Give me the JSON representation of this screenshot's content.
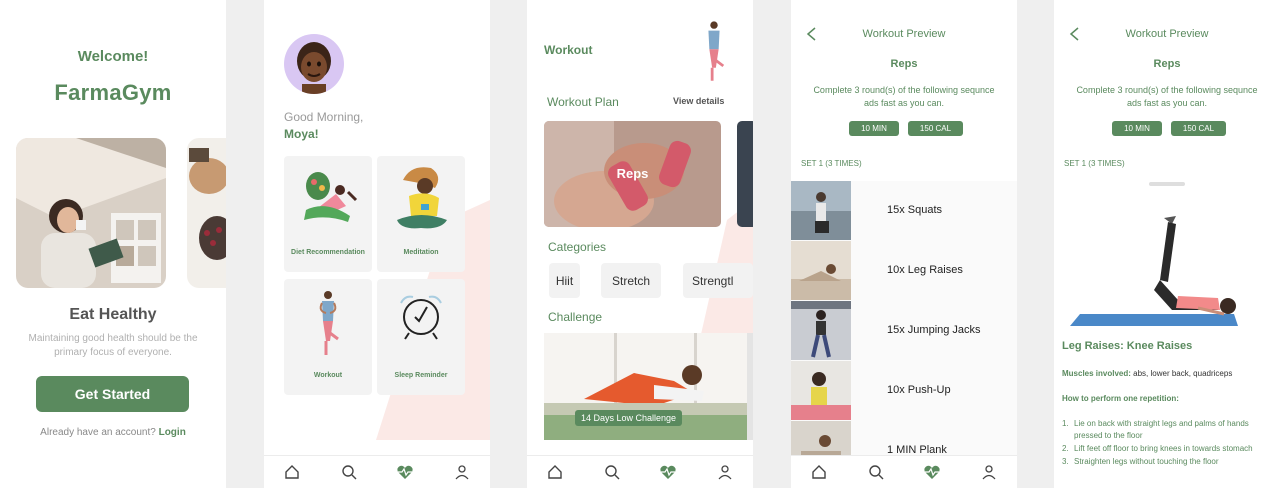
{
  "screen1": {
    "welcome": "Welcome!",
    "brand": "FarmaGym",
    "title": "Eat Healthy",
    "subtitle": "Maintaining good health should be the primary focus of everyone.",
    "cta": "Get Started",
    "account_prompt": "Already have an account?",
    "login": "Login"
  },
  "screen2": {
    "greeting": "Good Morning,",
    "name": "Moya!",
    "tiles": [
      {
        "label": "Diet Recommendation",
        "icon": "diet-illustration-icon"
      },
      {
        "label": "Meditation",
        "icon": "meditation-illustration-icon"
      },
      {
        "label": "Workout",
        "icon": "workout-illustration-icon"
      },
      {
        "label": "Sleep Reminder",
        "icon": "alarm-clock-icon"
      }
    ]
  },
  "screen3": {
    "title": "Workout",
    "plan_label": "Workout Plan",
    "view_details": "View details",
    "card_label": "Reps",
    "categories_label": "Categories",
    "categories": [
      "Hiit",
      "Stretch",
      "Strengtl"
    ],
    "challenge_label": "Challenge",
    "challenge_card": "14 Days Low Challenge"
  },
  "preview": {
    "title": "Workout Preview",
    "reps": "Reps",
    "instructions": "Complete 3 round(s) of the following sequnce ads fast as you can.",
    "duration": "10 MIN",
    "calories": "150 CAL",
    "set_label": "SET 1 (3 TIMES)"
  },
  "screen4": {
    "exercises": [
      "15x Squats",
      "10x Leg Raises",
      "15x Jumping Jacks",
      "10x Push-Up",
      "1 MIN Plank"
    ]
  },
  "screen5": {
    "exercise_title": "Leg Raises: Knee Raises",
    "muscles_label": "Muscles involved:",
    "muscles": "abs, lower back, quadriceps",
    "howto": "How to perform one repetition:",
    "steps": [
      {
        "n": "1.",
        "text": "Lie on back with straight legs and palms of hands pressed to the floor"
      },
      {
        "n": "2.",
        "text": "Lift feet off floor to bring knees in towards stomach"
      },
      {
        "n": "3.",
        "text": "Straighten legs without touching the floor"
      }
    ]
  },
  "nav": {
    "icons": [
      "home-icon",
      "search-icon",
      "activity-heart-icon",
      "profile-icon"
    ],
    "active": "activity-heart-icon"
  },
  "colors": {
    "primary": "#5a8a5e",
    "accent_deco": "#fbe9e6",
    "avatar_bg": "#d9c7f3"
  }
}
